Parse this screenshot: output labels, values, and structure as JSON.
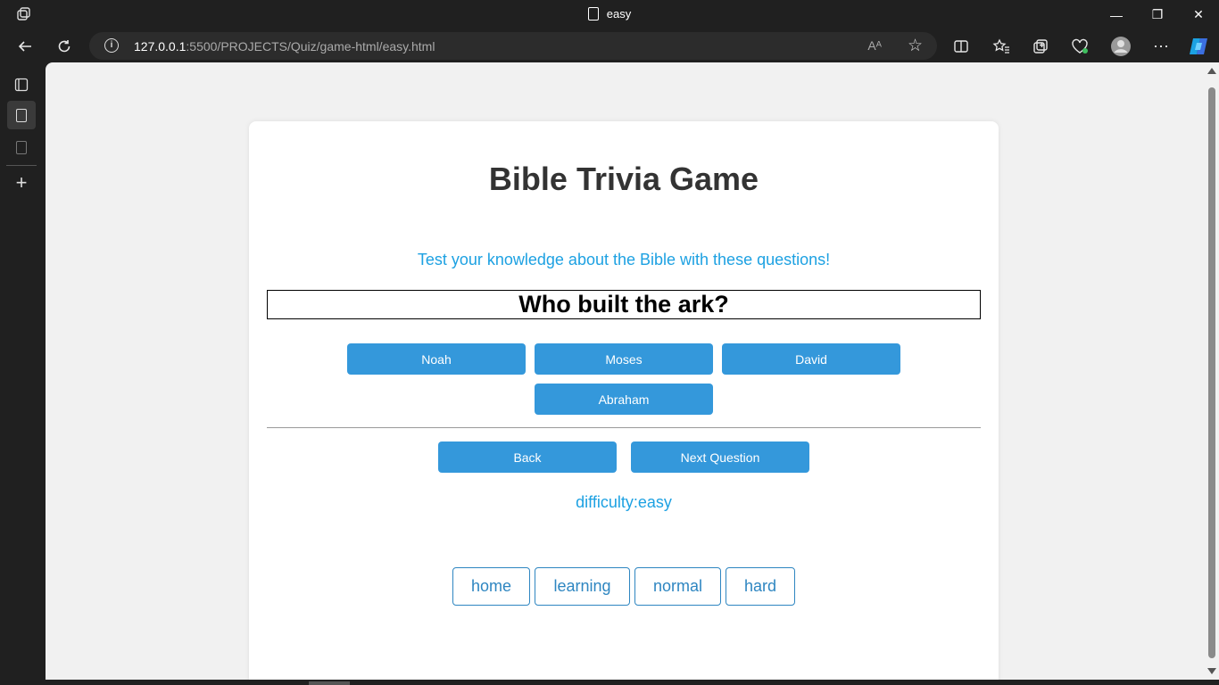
{
  "window": {
    "tab_title": "easy",
    "minimize": "—",
    "restore": "❐",
    "close": "✕"
  },
  "address_bar": {
    "url_host": "127.0.0.1",
    "url_rest": ":5500/PROJECTS/Quiz/game-html/easy.html",
    "read_aloud": "Aᴬ"
  },
  "page": {
    "title": "Bible Trivia Game",
    "subtitle": "Test your knowledge about the Bible with these questions!",
    "question": "Who built the ark?",
    "answers": [
      "Noah",
      "Moses",
      "David",
      "Abraham"
    ],
    "back_label": "Back",
    "next_label": "Next Question",
    "difficulty_text": "difficulty:easy",
    "nav_links": [
      "home",
      "learning",
      "normal",
      "hard"
    ]
  },
  "colors": {
    "accent_button": "#3498db",
    "subtitle_text": "#1da1e2",
    "link_border": "#2e86c1"
  }
}
